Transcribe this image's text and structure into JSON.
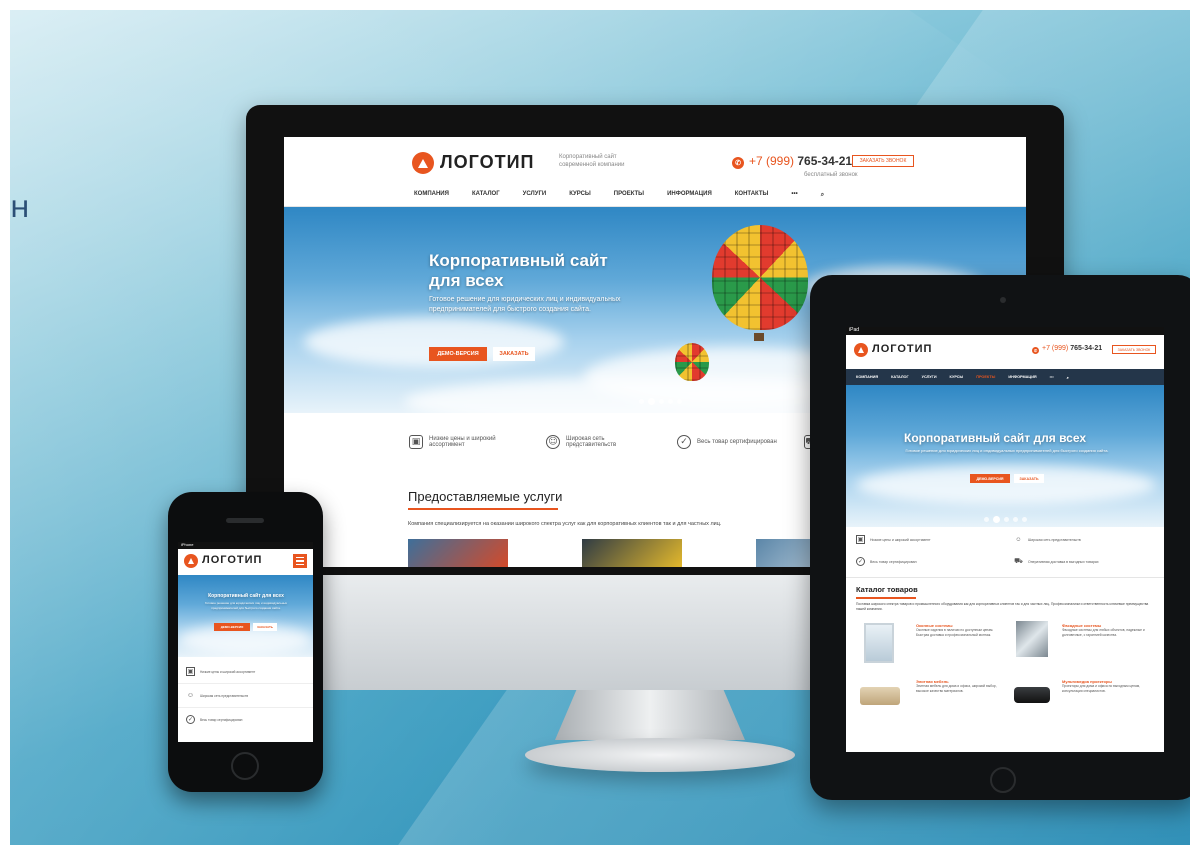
{
  "brand": {
    "logo_text": "ЛОГОТИП",
    "tagline": "Корпоративный сайт современной компании",
    "accent": "#e8551f"
  },
  "contact": {
    "phone_prefix": "+7 (999)",
    "phone_number": "765-34-21",
    "phone_note": "бесплатный звонок",
    "call_button": "Заказать звонок"
  },
  "nav": {
    "items": [
      "Компания",
      "Каталог",
      "Услуги",
      "Курсы",
      "Проекты",
      "Информация",
      "Контакты"
    ],
    "more": "•••",
    "search_icon": "search-icon"
  },
  "hero": {
    "title_line1": "Корпоративный сайт",
    "title_line2": "для всех",
    "title_full": "Корпоративный сайт для всех",
    "subtitle": "Готовое решение для юридических лиц и индивидуальных предпринимателей для быстрого создания сайта.",
    "demo_button": "Демо-версия",
    "order_button": "Заказать"
  },
  "features": [
    {
      "icon": "box-icon",
      "text": "Низкие цены и широкий ассортимент"
    },
    {
      "icon": "person-icon",
      "text": "Широкая сеть представительств"
    },
    {
      "icon": "shield-icon",
      "text": "Весь товар сертифицирован"
    },
    {
      "icon": "truck-icon",
      "text": "Оперативная доставка в выгодных товарах"
    }
  ],
  "services": {
    "title": "Предоставляемые услуги",
    "text": "Компания специализируется на оказании широкого спектра услуг как для корпоративных клиентов так и для частных лиц."
  },
  "catalog": {
    "title": "Каталог товаров",
    "text": "Поставка широкого спектра товаров и промышленного оборудования как для корпоративных клиентов так и для частных лиц. Профессионализм и ответственность ключевые преимущества нашей компании.",
    "items": [
      {
        "title": "Оконные системы",
        "text": "Оконные изделия в наличии по доступным ценам. Быстрая доставка и профессиональный монтаж."
      },
      {
        "title": "Фасадные системы",
        "text": "Фасадные системы для любых объектов, надежные и долговечные, с гарантией качества."
      },
      {
        "title": "Элитная мебель",
        "text": "Элитная мебель для дома и офиса, широкий выбор, высокое качество материалов."
      },
      {
        "title": "Мультимедиа проекторы",
        "text": "Проекторы для дома и офиса по выгодным ценам, консультация специалистов."
      }
    ]
  },
  "devices": {
    "tablet_status": "iPad",
    "phone_status": "iPhone"
  },
  "edge_glyph": "н"
}
